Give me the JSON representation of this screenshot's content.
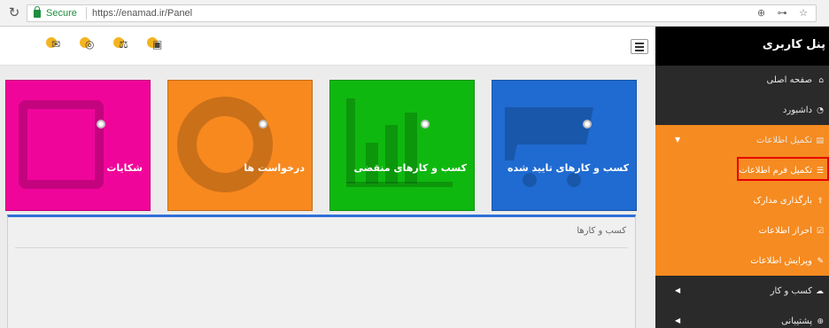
{
  "browser": {
    "secure_label": "Secure",
    "url": "https://enamad.ir/Panel",
    "right_icons": "⊕ ⊶ ☆"
  },
  "toolbar": {
    "icons": [
      "envelope-alert-icon",
      "lifebuoy-alert-icon",
      "scales-alert-icon",
      "calendar-alert-icon"
    ]
  },
  "sidebar": {
    "title": "پنل کاربری",
    "items": [
      {
        "label": "صفحه اصلی",
        "icon": "home-icon"
      },
      {
        "label": "داشبورد",
        "icon": "dashboard-icon"
      },
      {
        "label": "تکمیل اطلاعات",
        "icon": "form-icon"
      },
      {
        "label": "تکمیل فرم اطلاعات",
        "icon": "list-icon"
      },
      {
        "label": "بارگذاری مدارک",
        "icon": "upload-icon"
      },
      {
        "label": "احراز اطلاعات",
        "icon": "check-icon"
      },
      {
        "label": "ویرایش اطلاعات",
        "icon": "edit-icon"
      },
      {
        "label": "کسب و کار",
        "icon": "cloud-icon"
      },
      {
        "label": "پشتیبانی",
        "icon": "globe-icon"
      }
    ]
  },
  "tiles": [
    {
      "label": "کسب و کارهای تایید شده",
      "color": "#1f6bd1",
      "icon": "cart-icon"
    },
    {
      "label": "کسب و کارهای منقضی",
      "color": "#0fb80f",
      "icon": "bar-chart-icon"
    },
    {
      "label": "درخواست ها",
      "color": "#f7891f",
      "icon": "lifebuoy-icon"
    },
    {
      "label": "شکایات",
      "color": "#f0059a",
      "icon": "checkbox-icon"
    }
  ],
  "panel": {
    "title": "کسب و کارها"
  },
  "colors": {
    "accent": "#2f6fd8",
    "sidebar_active": "#f58b21",
    "sidebar_bg": "#2a2a2a",
    "highlight": "#e60000"
  }
}
